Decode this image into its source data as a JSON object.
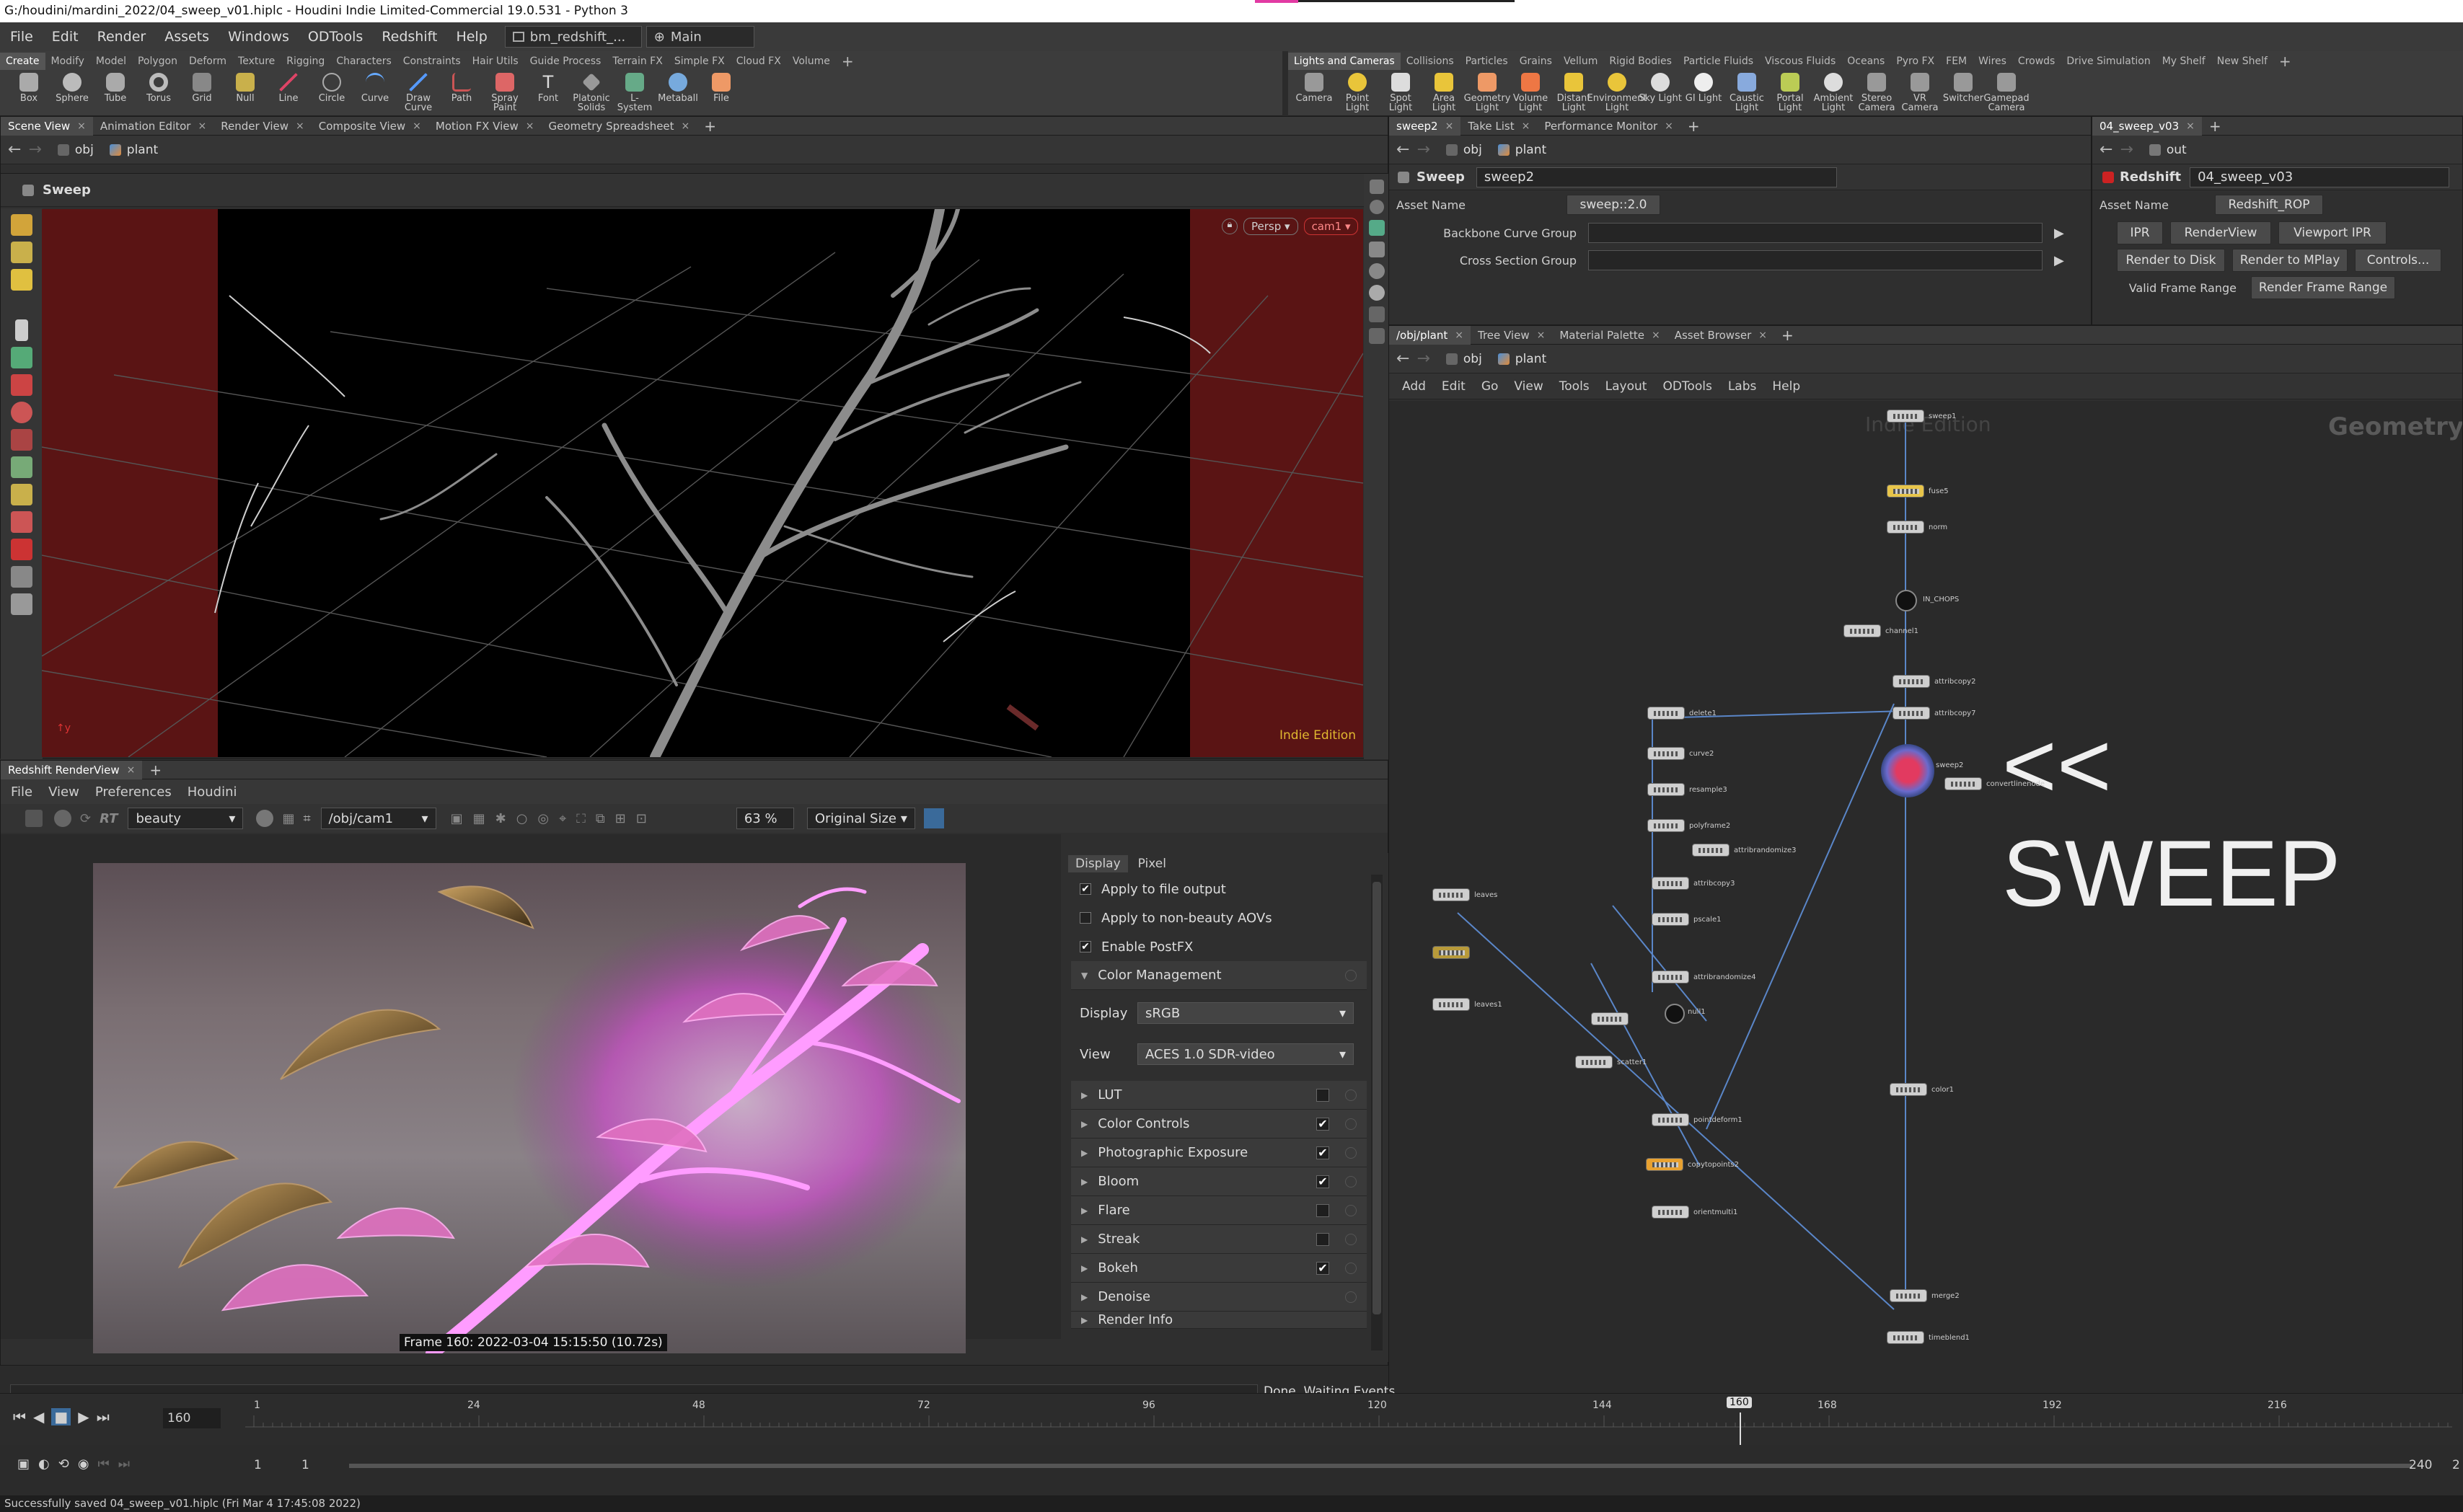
{
  "window": {
    "title": "G:/houdini/mardini_2022/04_sweep_v01.hiplc - Houdini Indie Limited-Commercial 19.0.531 - Python 3"
  },
  "menu": {
    "items": [
      "File",
      "Edit",
      "Render",
      "Assets",
      "Windows",
      "ODTools",
      "Redshift",
      "Help"
    ],
    "desktop": "bm_redshift_...",
    "context": "Main"
  },
  "shelf_left": {
    "tabs": [
      "Create",
      "Modify",
      "Model",
      "Polygon",
      "Deform",
      "Texture",
      "Rigging",
      "Characters",
      "Constraints",
      "Hair Utils",
      "Guide Process",
      "Terrain FX",
      "Simple FX",
      "Cloud FX",
      "Volume"
    ],
    "tools": [
      "Box",
      "Sphere",
      "Tube",
      "Torus",
      "Grid",
      "Null",
      "Line",
      "Circle",
      "Curve",
      "Draw Curve",
      "Path",
      "Spray Paint",
      "Font",
      "Platonic Solids",
      "L-System",
      "Metaball",
      "File"
    ]
  },
  "shelf_right": {
    "tabs": [
      "Lights and Cameras",
      "Collisions",
      "Particles",
      "Grains",
      "Vellum",
      "Rigid Bodies",
      "Particle Fluids",
      "Viscous Fluids",
      "Oceans",
      "Pyro FX",
      "FEM",
      "Wires",
      "Crowds",
      "Drive Simulation",
      "My Shelf",
      "New Shelf"
    ],
    "tools": [
      "Camera",
      "Point Light",
      "Spot Light",
      "Area Light",
      "Geometry Light",
      "Volume Light",
      "Distant Light",
      "Environment Light",
      "Sky Light",
      "GI Light",
      "Caustic Light",
      "Portal Light",
      "Ambient Light",
      "Stereo Camera",
      "VR Camera",
      "Switcher",
      "Gamepad Camera"
    ]
  },
  "viewport": {
    "tabs": [
      "Scene View",
      "Animation Editor",
      "Render View",
      "Composite View",
      "Motion FX View",
      "Geometry Spreadsheet"
    ],
    "path": [
      "obj",
      "plant"
    ],
    "title": "Sweep",
    "persp": "Persp",
    "cam": "cam1",
    "watermark": "Indie Edition"
  },
  "params": {
    "tabs": [
      "sweep2",
      "Take List",
      "Performance Monitor"
    ],
    "path": [
      "obj",
      "plant"
    ],
    "node_type": "Sweep",
    "node_name": "sweep2",
    "asset_name_label": "Asset Name",
    "asset_name_value": "sweep::2.0",
    "fields": [
      "Backbone Curve Group",
      "Cross Section Group"
    ]
  },
  "rop": {
    "tabs": [
      "04_sweep_v03"
    ],
    "path": "out",
    "node_type": "Redshift",
    "node_name": "04_sweep_v03",
    "asset_name_label": "Asset Name",
    "asset_name_value": "Redshift_ROP",
    "buttons": [
      "IPR",
      "RenderView",
      "Viewport IPR",
      "Render to Disk",
      "Render to MPlay",
      "Controls..."
    ],
    "frame_label": "Valid Frame Range",
    "frame_value": "Render Frame Range"
  },
  "network": {
    "tabs": [
      "/obj/plant",
      "Tree View",
      "Material Palette",
      "Asset Browser"
    ],
    "path": [
      "obj",
      "plant"
    ],
    "menu": [
      "Add",
      "Edit",
      "Go",
      "View",
      "Tools",
      "Layout",
      "ODTools",
      "Labs",
      "Help"
    ],
    "watermark": "Indie Edition",
    "context_label": "Geometry",
    "annotation": "<< SWEEP",
    "nodes": [
      "sweep1",
      "fuse5",
      "norm",
      "IN_CHOPS",
      "channel1",
      "attribcopy2",
      "attribcopy7",
      "delete1",
      "sweep2",
      "convertlinenode",
      "curve2",
      "resample3",
      "polyframe2",
      "attribrandomize3",
      "attribcopy3",
      "pscale1",
      "attribrandomize4",
      "null1",
      "leaves",
      "leaves1",
      "scatter1",
      "pointdeform1",
      "copytopoints2",
      "orientmulti1",
      "color1",
      "merge2",
      "timeblend1"
    ]
  },
  "renderview": {
    "tab": "Redshift RenderView",
    "menu": [
      "File",
      "View",
      "Preferences",
      "Houdini"
    ],
    "aov": "beauty",
    "camera": "/obj/cam1",
    "zoom": "63 %",
    "size": "Original Size",
    "frame_label": "Frame  160:  2022-03-04  15:15:50  (10.72s)",
    "status": "Done. Waiting Events",
    "panel_tabs": [
      "Display",
      "Pixel"
    ],
    "checks": [
      {
        "label": "Apply to file output",
        "checked": true
      },
      {
        "label": "Apply to non-beauty AOVs",
        "checked": false
      },
      {
        "label": "Enable PostFX",
        "checked": true
      }
    ],
    "color_mgmt": "Color Management",
    "display_label": "Display",
    "display_value": "sRGB",
    "view_label": "View",
    "view_value": "ACES 1.0 SDR-video",
    "sections": [
      {
        "label": "LUT",
        "checked": false
      },
      {
        "label": "Color Controls",
        "checked": true
      },
      {
        "label": "Photographic Exposure",
        "checked": true
      },
      {
        "label": "Bloom",
        "checked": true
      },
      {
        "label": "Flare",
        "checked": false
      },
      {
        "label": "Streak",
        "checked": false
      },
      {
        "label": "Bokeh",
        "checked": true
      },
      {
        "label": "Denoise",
        "checked": null
      },
      {
        "label": "Render Info",
        "checked": null
      }
    ]
  },
  "timeline": {
    "current_frame": "160",
    "ticks": [
      "1",
      "24",
      "48",
      "72",
      "96",
      "120",
      "144",
      "160",
      "168",
      "192",
      "216"
    ],
    "start": "1",
    "start2": "1",
    "end": "240",
    "end2": "2"
  },
  "status": {
    "message": "Successfully saved 04_sweep_v01.hiplc (Fri Mar 4 17:45:08 2022)"
  }
}
